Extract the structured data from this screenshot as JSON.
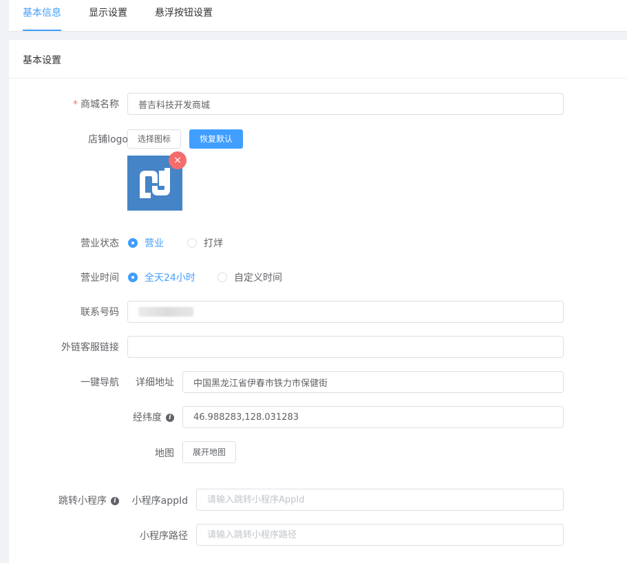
{
  "tabs": [
    {
      "label": "基本信息",
      "active": true
    },
    {
      "label": "显示设置",
      "active": false
    },
    {
      "label": "悬浮按钮设置",
      "active": false
    }
  ],
  "panel": {
    "title": "基本设置"
  },
  "form": {
    "shop_name": {
      "label": "商城名称",
      "required_mark": "*",
      "value": "普吉科技开发商城"
    },
    "logo": {
      "label": "店铺logo",
      "select_button": "选择图标",
      "reset_button": "恢复默认",
      "remove_icon": "×",
      "logo_icon": "logo-icon"
    },
    "status": {
      "label": "营业状态",
      "options": [
        "营业",
        "打烊"
      ],
      "selected": "营业"
    },
    "hours": {
      "label": "营业时间",
      "options": [
        "全天24小时",
        "自定义时间"
      ],
      "selected": "全天24小时"
    },
    "phone": {
      "label": "联系号码",
      "value": ""
    },
    "service_link": {
      "label": "外链客服链接",
      "value": ""
    },
    "navigation": {
      "label": "一键导航",
      "address_label": "详细地址",
      "address_value": "中国黑龙江省伊春市铁力市保健街",
      "coords_label": "经纬度",
      "coords_value": "46.988283,128.031283",
      "map_label": "地图",
      "map_button": "展开地图"
    },
    "mini_program": {
      "label": "跳转小程序",
      "appid_label": "小程序appId",
      "appid_placeholder": "请输入跳转小程序AppId",
      "path_label": "小程序路径",
      "path_placeholder": "请输入跳转小程序路径"
    },
    "info_icon": "i"
  },
  "colors": {
    "accent": "#409eff",
    "danger": "#f56c6c",
    "logo_bg": "#4584c6"
  }
}
